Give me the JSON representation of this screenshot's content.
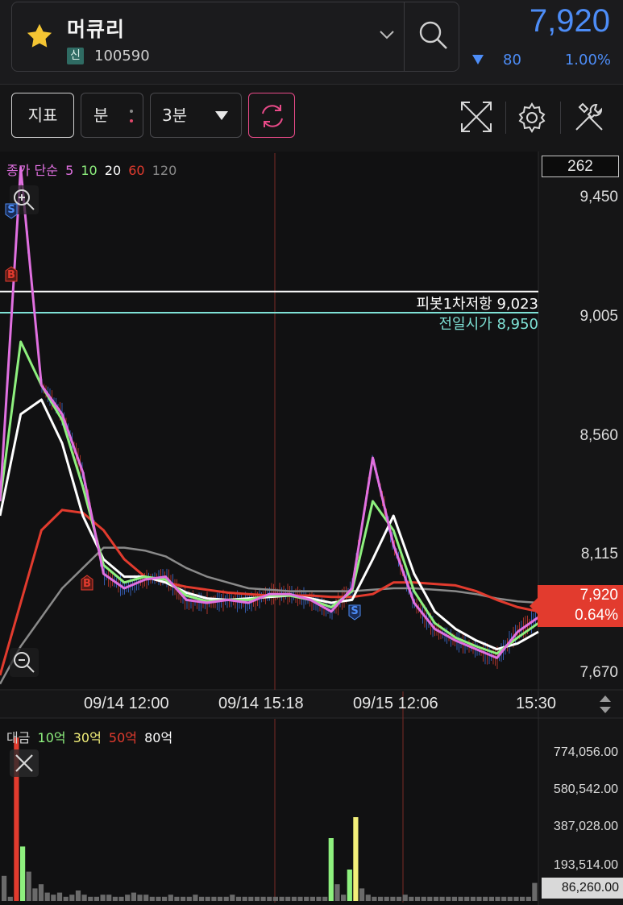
{
  "stock": {
    "name": "머큐리",
    "market_badge": "신",
    "code": "100590",
    "price": "7,920",
    "change": "80",
    "change_pct": "1.00%",
    "direction": "down",
    "color_down": "#4d8df7"
  },
  "toolbar": {
    "indicator_label": "지표",
    "unit_label": "분",
    "interval_value": "3분",
    "icons": [
      "refresh-icon",
      "expand-icon",
      "gear-icon",
      "tools-icon"
    ]
  },
  "legend": {
    "price_prefix": "종가 단순",
    "ma": [
      {
        "label": "5",
        "color": "#e070e0"
      },
      {
        "label": "10",
        "color": "#8ef07e"
      },
      {
        "label": "20",
        "color": "#ffffff"
      },
      {
        "label": "60",
        "color": "#e23b2e"
      },
      {
        "label": "120",
        "color": "#8a8a8a"
      }
    ]
  },
  "volume_legend": {
    "prefix": "대금",
    "levels": [
      {
        "label": "10억",
        "color": "#8ef07e"
      },
      {
        "label": "30억",
        "color": "#f3f07a"
      },
      {
        "label": "50억",
        "color": "#e23b2e"
      },
      {
        "label": "80억",
        "color": "#ffffff"
      }
    ]
  },
  "chart": {
    "visible_count": "262",
    "y_ticks": [
      "9,450",
      "9,005",
      "8,560",
      "8,115",
      "7,670"
    ],
    "x_ticks": [
      "09/14 12:00",
      "09/14 15:18",
      "09/15 12:06",
      "15:30"
    ],
    "pivot_label": "피봇1차저항 9,023",
    "prev_open_label": "전일시가 8,950",
    "current_price": "7,920",
    "current_pct": "0.64%",
    "markers": [
      "S",
      "B",
      "B",
      "S"
    ],
    "volume_ticks": [
      "774,056.00",
      "580,542.00",
      "387,028.00",
      "193,514.00"
    ],
    "current_volume": "86,260.00"
  },
  "chart_data": {
    "type": "line",
    "y_range": [
      7650,
      9500
    ],
    "pivot_resistance_1": 9023,
    "prev_day_open": 8950,
    "last_close": 7920,
    "series": [
      {
        "name": "5",
        "color": "#e070e0",
        "values": [
          8300,
          9450,
          8700,
          8600,
          8400,
          8050,
          8000,
          8030,
          8040,
          7960,
          7950,
          7960,
          7950,
          7980,
          7980,
          7960,
          7920,
          8000,
          8450,
          8150,
          7950,
          7860,
          7820,
          7790,
          7760,
          7850,
          7900
        ]
      },
      {
        "name": "10",
        "color": "#8ef07e",
        "values": [
          8300,
          8850,
          8700,
          8580,
          8350,
          8080,
          8020,
          8040,
          8030,
          7975,
          7955,
          7960,
          7960,
          7975,
          7975,
          7960,
          7935,
          7990,
          8300,
          8200,
          7990,
          7880,
          7830,
          7800,
          7775,
          7830,
          7880
        ]
      },
      {
        "name": "20",
        "color": "#ffffff",
        "values": [
          8250,
          8600,
          8650,
          8500,
          8250,
          8100,
          8040,
          8040,
          8020,
          7985,
          7965,
          7960,
          7965,
          7970,
          7975,
          7965,
          7950,
          7960,
          8100,
          8250,
          8050,
          7920,
          7860,
          7820,
          7790,
          7810,
          7850
        ]
      },
      {
        "name": "60",
        "color": "#e23b2e",
        "values": [
          7700,
          7950,
          8200,
          8270,
          8260,
          8200,
          8100,
          8040,
          8020,
          8005,
          7995,
          7985,
          7980,
          7975,
          7975,
          7975,
          7970,
          7970,
          7980,
          8020,
          8020,
          8015,
          8010,
          7990,
          7960,
          7935,
          7920
        ]
      },
      {
        "name": "120",
        "color": "#8a8a8a",
        "values": [
          7670,
          7800,
          7900,
          8000,
          8070,
          8140,
          8140,
          8130,
          8110,
          8070,
          8040,
          8020,
          8000,
          7995,
          7990,
          7990,
          7990,
          7990,
          7995,
          8000,
          8000,
          7995,
          7990,
          7980,
          7965,
          7955,
          7950
        ]
      }
    ],
    "volume": [
      120,
      20,
      780,
      260,
      140,
      60,
      80,
      40,
      30,
      40,
      20,
      30,
      50,
      30,
      20,
      20,
      30,
      30,
      20,
      20,
      30,
      40,
      30,
      30,
      20,
      20,
      20,
      30,
      20,
      20,
      20,
      30,
      20,
      20,
      20,
      20,
      20,
      30,
      20,
      20,
      20,
      20,
      20,
      20,
      20,
      20,
      20,
      20,
      20,
      20,
      20,
      20,
      20,
      300,
      80,
      30,
      150,
      400,
      60,
      30,
      20,
      20,
      20,
      20,
      20,
      30,
      20,
      20,
      20,
      20,
      20,
      20,
      20,
      20,
      20,
      20,
      20,
      20,
      20,
      20,
      20,
      20,
      20,
      20,
      20,
      20,
      86
    ]
  }
}
